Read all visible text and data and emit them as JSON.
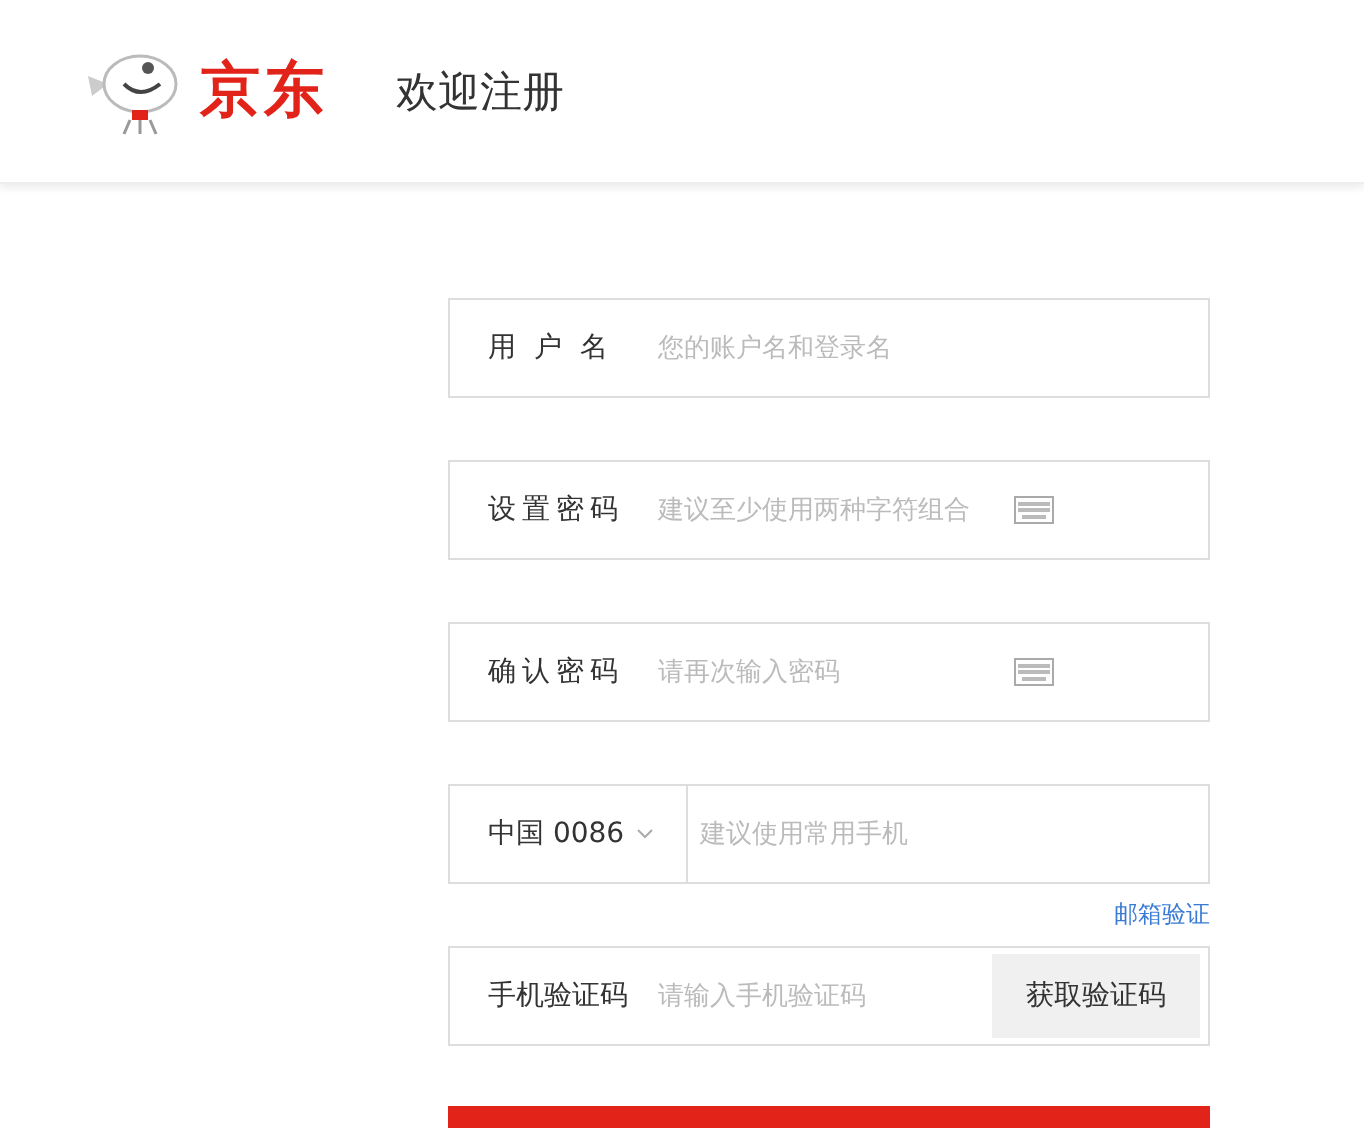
{
  "header": {
    "logo_text": "京东",
    "title": "欢迎注册"
  },
  "fields": [
    {
      "kind": "text",
      "label": "用户名",
      "placeholder": "您的账户名和登录名",
      "keyboard": false
    },
    {
      "kind": "text",
      "label": "设置密码",
      "placeholder": "建议至少使用两种字符组合",
      "keyboard": true
    },
    {
      "kind": "text",
      "label": "确认密码",
      "placeholder": "请再次输入密码",
      "keyboard": true
    },
    {
      "kind": "phone",
      "country": "中国 0086",
      "placeholder": "建议使用常用手机",
      "link": "邮箱验证"
    },
    {
      "kind": "code",
      "label": "手机验证码",
      "placeholder": "请输入手机验证码",
      "button": "获取验证码"
    }
  ]
}
